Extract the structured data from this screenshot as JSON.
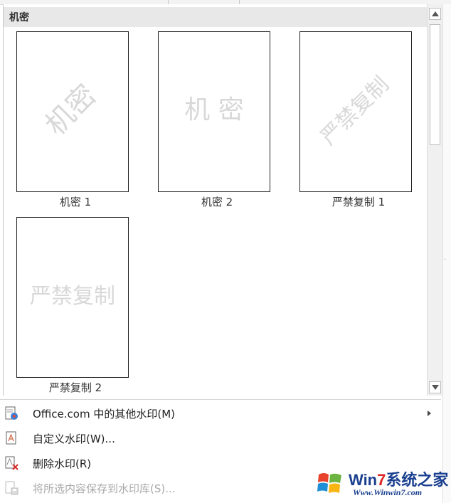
{
  "gallery": {
    "section_title": "机密",
    "items": [
      {
        "label": "机密 1",
        "watermark": "机密",
        "layout": "diagonal"
      },
      {
        "label": "机密 2",
        "watermark": "机 密",
        "layout": "horizontal"
      },
      {
        "label": "严禁复制 1",
        "watermark": "严禁复制",
        "layout": "diagonal"
      },
      {
        "label": "严禁复制 2",
        "watermark": "严禁复制",
        "layout": "horizontal"
      }
    ]
  },
  "menu": {
    "items": [
      {
        "label": "Office.com 中的其他水印(M)",
        "icon": "office-watermark-icon",
        "enabled": true,
        "submenu": true
      },
      {
        "label": "自定义水印(W)...",
        "icon": "custom-watermark-icon",
        "enabled": true,
        "submenu": false
      },
      {
        "label": "删除水印(R)",
        "icon": "remove-watermark-icon",
        "enabled": true,
        "submenu": false
      },
      {
        "label": "将所选内容保存到水印库(S)...",
        "icon": "save-to-gallery-icon",
        "enabled": false,
        "submenu": false
      }
    ]
  },
  "brand": {
    "name_prefix": "Win",
    "name_seven": "7",
    "name_suffix": "系统之家",
    "url": "Www.Winwin7.com"
  },
  "colors": {
    "header_bg": "#e8e8e8",
    "watermark_gray": "#d8d8d8",
    "brand_blue": "#1a3f8f",
    "brand_red": "#d22222"
  }
}
